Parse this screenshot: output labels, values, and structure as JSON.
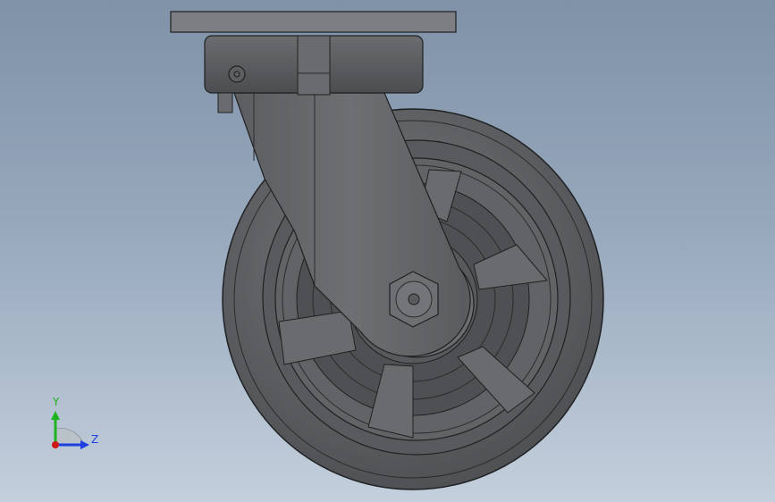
{
  "viewport": {
    "background_top": "#7f92a8",
    "background_bottom": "#c3cfdc",
    "model_body_color": "#5f6063",
    "model_edge_color": "#1f2022"
  },
  "triad": {
    "y_label": "Y",
    "z_label": "Z",
    "y_color": "#1db31d",
    "z_color": "#1f3fe0",
    "origin_color": "#d01818"
  }
}
